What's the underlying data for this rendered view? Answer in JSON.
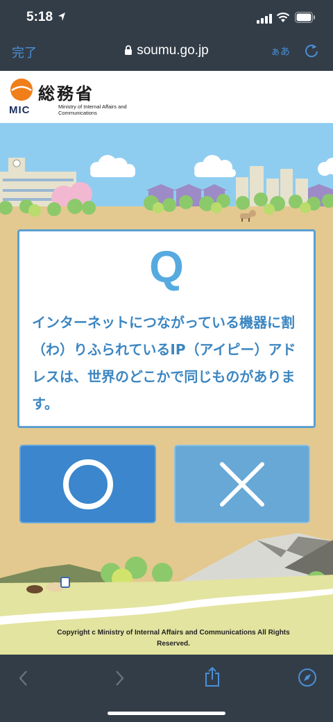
{
  "status_bar": {
    "time": "5:18"
  },
  "browser": {
    "done_label": "完了",
    "url": "soumu.go.jp",
    "text_size_label": "ぁあ"
  },
  "site": {
    "logo_abbr": "MIC",
    "ministry_name_jp": "総務省",
    "ministry_name_en": "Ministry of Internal Affairs and Communications",
    "accent_color": "#f07f1a"
  },
  "quiz": {
    "question_mark": "Q",
    "question_text": "インターネットにつながっている機器に割（わ）りふられているIP（アイピー）アドレスは、世界のどこかで同じものがあります。",
    "answer_true_symbol": "circle",
    "answer_false_symbol": "cross"
  },
  "footer": {
    "copyright": "Copyright c Ministry of Internal Affairs and Communications All Rights Reserved."
  },
  "toolbar": {
    "icons": [
      "back-icon",
      "forward-icon",
      "share-icon",
      "compass-icon"
    ]
  }
}
